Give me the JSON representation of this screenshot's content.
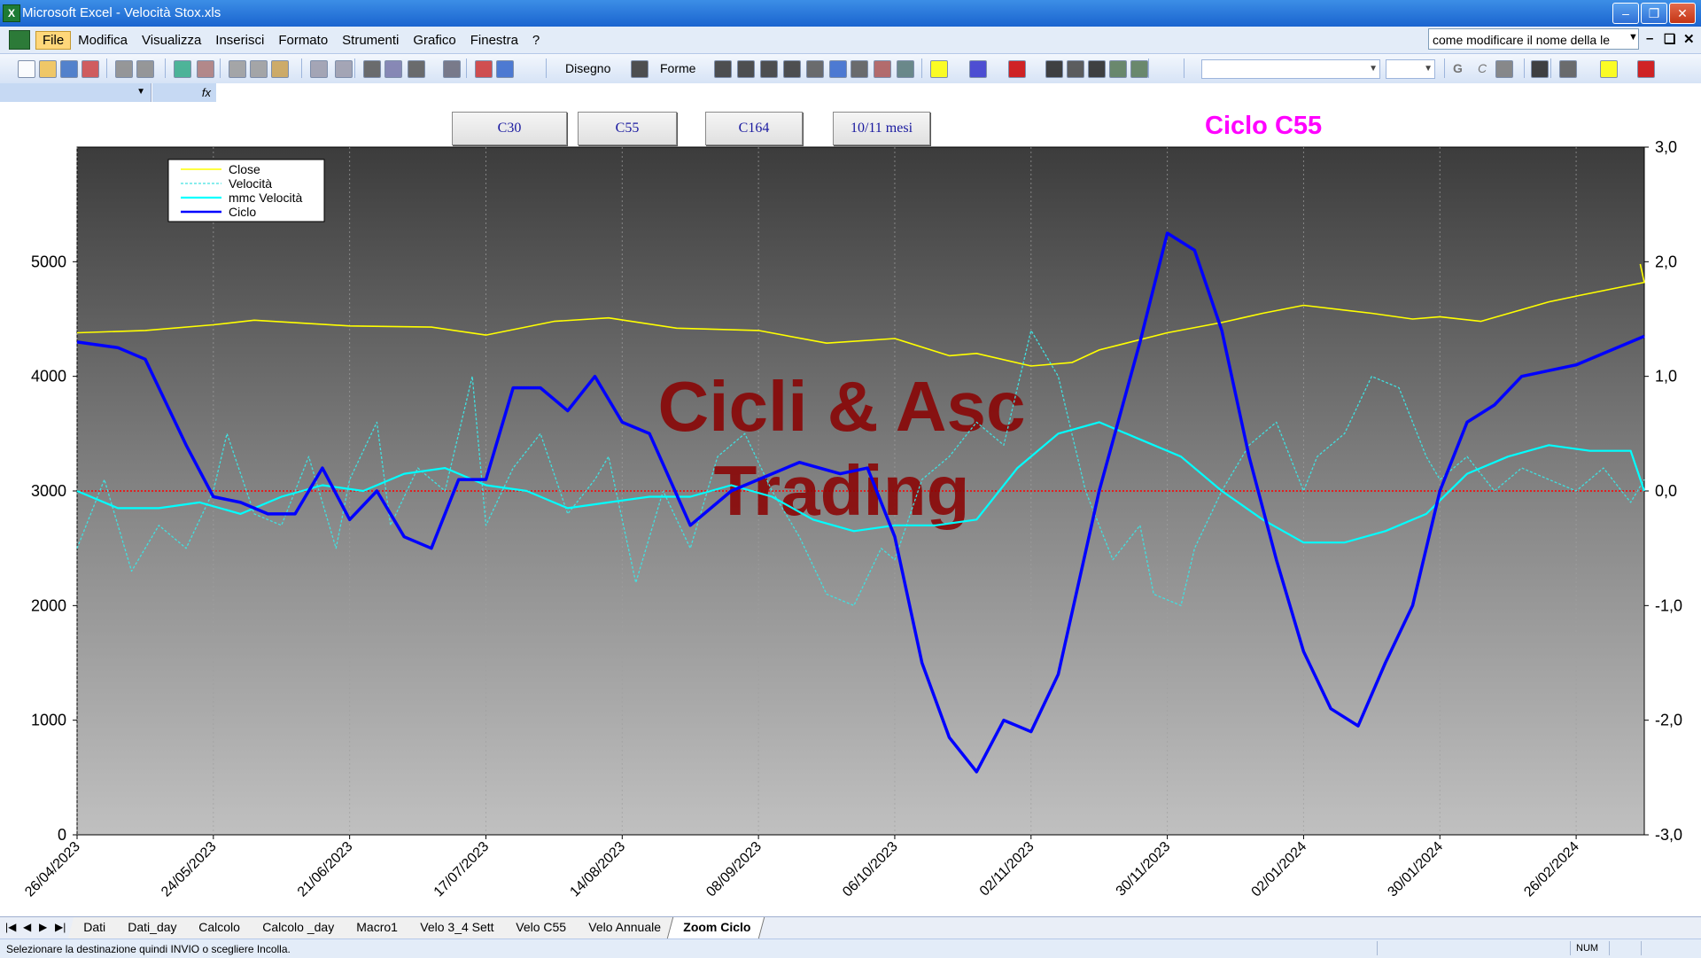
{
  "window": {
    "title": "Microsoft Excel - Velocità Stox.xls",
    "app_icon": "X"
  },
  "menu": {
    "items": [
      "File",
      "Modifica",
      "Visualizza",
      "Inserisci",
      "Formato",
      "Strumenti",
      "Grafico",
      "Finestra",
      "?"
    ],
    "active": "File",
    "help_box": "come modificare il nome della le"
  },
  "toolbar": {
    "drawing_label": "Disegno",
    "shapes_label": "Forme",
    "bold": "G",
    "italic": "C"
  },
  "formula_bar": {
    "fx": "fx"
  },
  "chart_buttons": [
    "C30",
    "C55",
    "C164",
    "10/11 mesi"
  ],
  "chart_heading": "Ciclo C55",
  "watermark": [
    "Cicli & Asc",
    "Trading"
  ],
  "colors": {
    "close": "#ffff00",
    "velocita": "#40e0e0",
    "mmc": "#00ffff",
    "ciclo": "#0000ff",
    "heading": "#ff00ff",
    "watermark": "#8b0000",
    "zero_line": "#ff0000"
  },
  "chart_data": {
    "type": "line",
    "legend": [
      "Close",
      "Velocità",
      "mmc Velocità",
      "Ciclo"
    ],
    "legend_position": "top-left",
    "y_left": {
      "range": [
        0,
        6000
      ],
      "ticks": [
        "0",
        "1000",
        "2000",
        "3000",
        "4000",
        "5000"
      ]
    },
    "y_right": {
      "range": [
        -3.0,
        3.0
      ],
      "ticks": [
        "3,0",
        "2,0",
        "1,0",
        "0,0",
        "-1,0",
        "-2,0",
        "-3,0"
      ]
    },
    "x_ticks": [
      "26/04/2023",
      "24/05/2023",
      "21/06/2023",
      "17/07/2023",
      "14/08/2023",
      "08/09/2023",
      "06/10/2023",
      "02/11/2023",
      "30/11/2023",
      "02/01/2024",
      "30/01/2024",
      "26/02/2024"
    ],
    "series": [
      {
        "name": "Close",
        "axis": "left",
        "x": [
          0,
          0.5,
          1,
          1.3,
          2,
          2.6,
          3,
          3.5,
          3.9,
          4.4,
          5,
          5.5,
          6,
          6.4,
          6.6,
          7,
          7.3,
          7.5,
          8,
          8.4,
          8.7,
          9,
          9.5,
          9.8,
          10,
          10.3,
          10.8,
          11,
          11.5,
          11.47
        ],
        "values": [
          4380,
          4400,
          4450,
          4490,
          4440,
          4430,
          4360,
          4480,
          4510,
          4420,
          4400,
          4290,
          4330,
          4180,
          4200,
          4090,
          4120,
          4230,
          4380,
          4470,
          4550,
          4620,
          4550,
          4500,
          4520,
          4480,
          4650,
          4700,
          4820,
          4980
        ]
      },
      {
        "name": "Velocità",
        "axis": "right",
        "x": [
          0,
          0.2,
          0.4,
          0.6,
          0.8,
          1,
          1.1,
          1.3,
          1.5,
          1.7,
          1.9,
          2,
          2.2,
          2.3,
          2.5,
          2.7,
          2.9,
          3,
          3.2,
          3.4,
          3.6,
          3.8,
          3.9,
          4.1,
          4.3,
          4.5,
          4.7,
          4.9,
          5.1,
          5.3,
          5.5,
          5.7,
          5.9,
          6,
          6.2,
          6.4,
          6.6,
          6.8,
          7,
          7.2,
          7.4,
          7.6,
          7.8,
          7.9,
          8.1,
          8.2,
          8.4,
          8.6,
          8.8,
          9,
          9.1,
          9.3,
          9.5,
          9.7,
          9.9,
          10,
          10.2,
          10.4,
          10.6,
          10.8,
          11,
          11.2,
          11.4,
          11.5
        ],
        "values": [
          -0.5,
          0.1,
          -0.7,
          -0.3,
          -0.5,
          0.0,
          0.5,
          -0.2,
          -0.3,
          0.3,
          -0.5,
          0.1,
          0.6,
          -0.3,
          0.2,
          0.0,
          1.0,
          -0.3,
          0.2,
          0.5,
          -0.2,
          0.1,
          0.3,
          -0.8,
          0.0,
          -0.5,
          0.3,
          0.5,
          0.0,
          -0.4,
          -0.9,
          -1.0,
          -0.5,
          -0.6,
          0.1,
          0.3,
          0.6,
          0.4,
          1.4,
          1.0,
          0.0,
          -0.6,
          -0.3,
          -0.9,
          -1.0,
          -0.5,
          0.0,
          0.4,
          0.6,
          0.0,
          0.3,
          0.5,
          1.0,
          0.9,
          0.3,
          0.1,
          0.3,
          0.0,
          0.2,
          0.1,
          0.0,
          0.2,
          -0.1,
          0.1
        ]
      },
      {
        "name": "mmc Velocità",
        "axis": "right",
        "x": [
          0,
          0.3,
          0.6,
          0.9,
          1.2,
          1.5,
          1.8,
          2.1,
          2.4,
          2.7,
          3.0,
          3.3,
          3.6,
          3.9,
          4.2,
          4.5,
          4.8,
          5.1,
          5.4,
          5.7,
          6.0,
          6.3,
          6.6,
          6.9,
          7.2,
          7.5,
          7.8,
          8.1,
          8.4,
          8.7,
          9.0,
          9.3,
          9.6,
          9.9,
          10.2,
          10.5,
          10.8,
          11.1,
          11.4,
          11.5
        ],
        "values": [
          0.0,
          -0.15,
          -0.15,
          -0.1,
          -0.2,
          -0.05,
          0.05,
          0.0,
          0.15,
          0.2,
          0.05,
          0.0,
          -0.15,
          -0.1,
          -0.05,
          -0.05,
          0.05,
          -0.05,
          -0.25,
          -0.35,
          -0.3,
          -0.3,
          -0.25,
          0.2,
          0.5,
          0.6,
          0.45,
          0.3,
          0.0,
          -0.25,
          -0.45,
          -0.45,
          -0.35,
          -0.2,
          0.15,
          0.3,
          0.4,
          0.35,
          0.35,
          0.0
        ]
      },
      {
        "name": "Ciclo",
        "axis": "right",
        "x": [
          0,
          0.3,
          0.5,
          0.8,
          1.0,
          1.2,
          1.4,
          1.6,
          1.8,
          2.0,
          2.2,
          2.4,
          2.6,
          2.8,
          3.0,
          3.2,
          3.4,
          3.6,
          3.8,
          4.0,
          4.2,
          4.5,
          4.8,
          5.0,
          5.3,
          5.6,
          5.8,
          6.0,
          6.2,
          6.4,
          6.6,
          6.8,
          7.0,
          7.2,
          7.5,
          7.8,
          8.0,
          8.2,
          8.4,
          8.6,
          8.8,
          9.0,
          9.2,
          9.4,
          9.6,
          9.8,
          10.0,
          10.2,
          10.4,
          10.6,
          10.8,
          11.0,
          11.2,
          11.5
        ],
        "values": [
          1.3,
          1.25,
          1.15,
          0.4,
          -0.05,
          -0.1,
          -0.2,
          -0.2,
          0.2,
          -0.25,
          0.0,
          -0.4,
          -0.5,
          0.1,
          0.1,
          0.9,
          0.9,
          0.7,
          1.0,
          0.6,
          0.5,
          -0.3,
          0.0,
          0.1,
          0.25,
          0.15,
          0.2,
          -0.4,
          -1.5,
          -2.15,
          -2.45,
          -2.0,
          -2.1,
          -1.6,
          0.0,
          1.3,
          2.25,
          2.1,
          1.4,
          0.3,
          -0.6,
          -1.4,
          -1.9,
          -2.05,
          -1.5,
          -1.0,
          0.0,
          0.6,
          0.75,
          1.0,
          1.05,
          1.1,
          1.2,
          1.35
        ]
      }
    ]
  },
  "sheet_tabs": [
    "Dati",
    "Dati_day",
    "Calcolo",
    "Calcolo _day",
    "Macro1",
    "Velo 3_4 Sett",
    "Velo C55",
    "Velo Annuale",
    "Zoom Ciclo"
  ],
  "active_tab": "Zoom Ciclo",
  "nav_arrows": [
    "|◀",
    "◀",
    "▶",
    "▶|"
  ],
  "status": {
    "message": "Selezionare la destinazione quindi INVIO o scegliere Incolla.",
    "num": "NUM"
  }
}
